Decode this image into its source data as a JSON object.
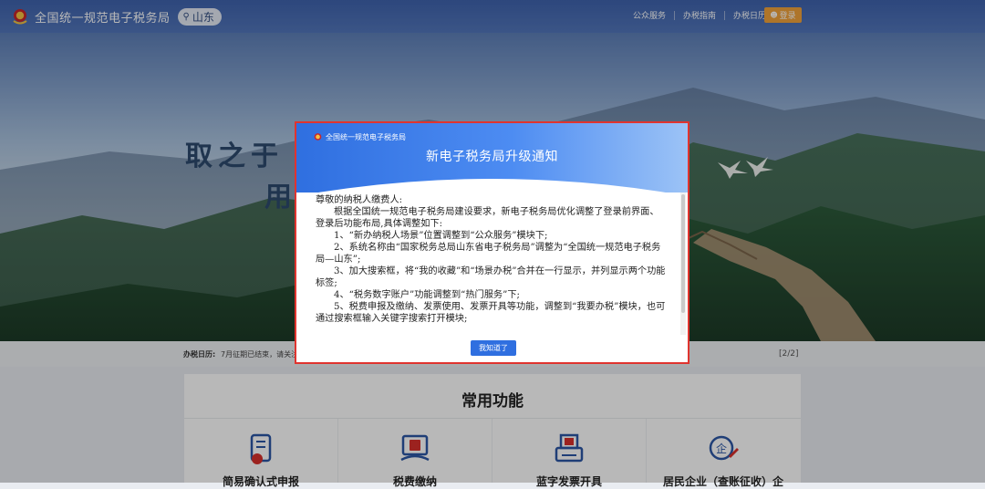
{
  "header": {
    "site_title": "全国统一规范电子税务局",
    "region": "山东",
    "links": [
      "公众服务",
      "办税指南",
      "办税日历"
    ],
    "login_label": "登录"
  },
  "hero": {
    "slogan_line1": "取之于",
    "slogan_line2": "用"
  },
  "notice": {
    "label": "办税日历:",
    "text": "7月征期已结束，请关注",
    "pager": "[2/2]"
  },
  "features": {
    "title": "常用功能",
    "items": [
      {
        "label": "简易确认式申报",
        "icon": "scroll-doc-icon"
      },
      {
        "label": "税费缴纳",
        "icon": "tax-payment-icon"
      },
      {
        "label": "蓝字发票开具",
        "icon": "invoice-printer-icon"
      },
      {
        "label": "居民企业（查账征收）企",
        "icon": "enterprise-stamp-icon"
      }
    ]
  },
  "modal": {
    "brand": "全国统一规范电子税务局",
    "title": "新电子税务局升级通知",
    "greeting": "尊敬的纳税人缴费人:",
    "intro": "根据全国统一规范电子税务局建设要求，新电子税务局优化调整了登录前界面、登录后功能布局,具体调整如下:",
    "items": [
      "1、“新办纳税人场景”位置调整到“公众服务”模块下;",
      "2、系统名称由“国家税务总局山东省电子税务局”调整为“全国统一规范电子税务局—山东”;",
      "3、加大搜索框，将“我的收藏”和“场景办税”合并在一行显示，并列显示两个功能标签;",
      "4、“税务数字账户”功能调整到“热门服务”下;",
      "5、税费申报及缴纳、发票使用、发票开具等功能，调整到“我要办税”模块，也可通过搜索框输入关键字搜索打开模块;"
    ],
    "ok_label": "我知道了"
  },
  "colors": {
    "topbar": "#4569b0",
    "accent_blue": "#2f6fe0",
    "login_orange": "#f1a23b",
    "modal_border": "#e0342f",
    "icon_blue": "#2c57a6",
    "icon_red": "#d9302b"
  }
}
